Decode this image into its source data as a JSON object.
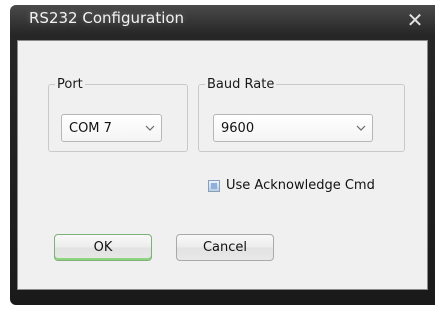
{
  "window": {
    "title": "RS232 Configuration",
    "close_symbol": "✕"
  },
  "port": {
    "label": "Port",
    "selected": "COM 7"
  },
  "baud_rate": {
    "label": "Baud Rate",
    "selected": "9600"
  },
  "acknowledge": {
    "label": "Use Acknowledge Cmd",
    "checked": true
  },
  "buttons": {
    "ok_label": "OK",
    "cancel_label": "Cancel"
  },
  "colors": {
    "frame": "#1a1a1a",
    "client_bg": "#f0f0f0",
    "ok_accent": "#8ed37e",
    "checkbox_fill": "#8fb0d8"
  },
  "icons": {
    "close": "close-icon",
    "dropdown": "chevron-down-icon"
  }
}
